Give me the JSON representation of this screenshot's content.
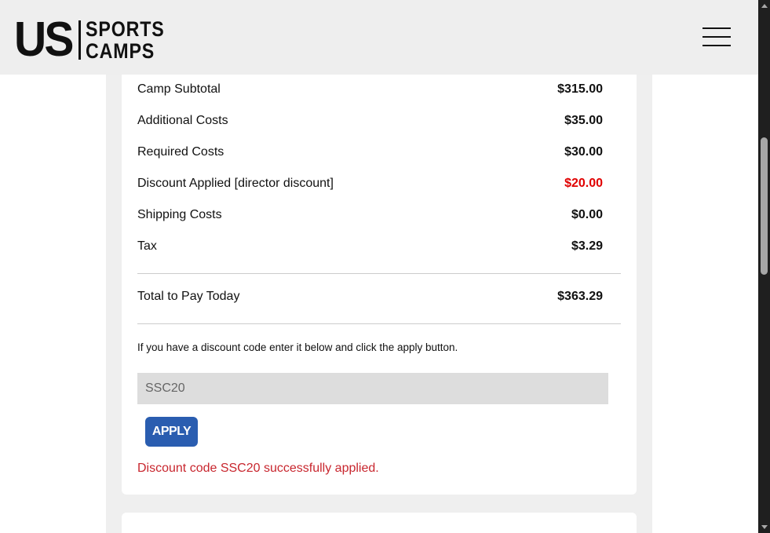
{
  "header": {
    "logo": {
      "us": "US",
      "line1": "SPORTS",
      "line2": "CAMPS"
    },
    "menu_icon": "hamburger-menu-icon"
  },
  "summary": {
    "rows": [
      {
        "label": "Camp Subtotal",
        "value": "$315.00"
      },
      {
        "label": "Additional Costs",
        "value": "$35.00"
      },
      {
        "label": "Required Costs",
        "value": "$30.00"
      },
      {
        "label": "Discount Applied [director discount]",
        "value": "$20.00"
      },
      {
        "label": "Shipping Costs",
        "value": "$0.00"
      },
      {
        "label": "Tax",
        "value": "$3.29"
      }
    ],
    "total_label": "Total to Pay Today",
    "total_value": "$363.29"
  },
  "discount": {
    "note": "If you have a discount code enter it below and click the apply button.",
    "code_value": "SSC20",
    "apply_label": "APPLY",
    "success_message": "Discount code SSC20 successfully applied."
  },
  "colors": {
    "header_bg": "#eeeeee",
    "discount_red": "#e00000",
    "success_red": "#c8262e",
    "apply_blue": "#2a5db0"
  }
}
